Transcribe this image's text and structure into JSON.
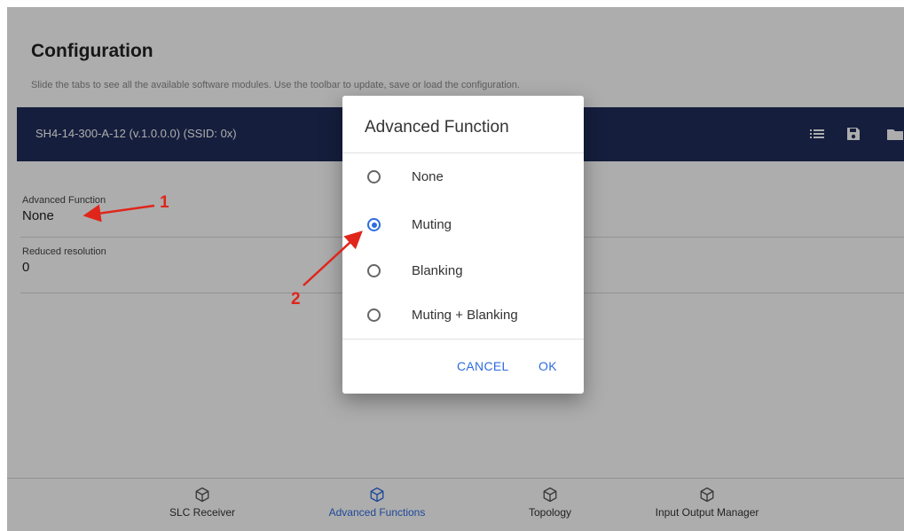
{
  "page": {
    "title": "Configuration",
    "subtitle": "Slide the tabs to see all the available software modules. Use the toolbar to update, save or load the configuration."
  },
  "device_bar": {
    "name": "SH4-14-300-A-12 (v.1.0.0.0) (SSID: 0x)",
    "icons": [
      "list-icon",
      "save-icon",
      "folder-icon"
    ]
  },
  "fields": [
    {
      "label": "Advanced Function",
      "value": "None"
    },
    {
      "label": "Reduced resolution",
      "value": "0"
    }
  ],
  "dialog": {
    "title": "Advanced Function",
    "options": [
      {
        "label": "None",
        "checked": false
      },
      {
        "label": "Muting",
        "checked": true
      },
      {
        "label": "Blanking",
        "checked": false
      },
      {
        "label": "Muting + Blanking",
        "checked": false
      }
    ],
    "cancel_label": "CANCEL",
    "ok_label": "OK"
  },
  "bottom_nav": [
    {
      "label": "SLC Receiver",
      "icon": "cube-icon",
      "active": false
    },
    {
      "label": "Advanced Functions",
      "icon": "cube-icon",
      "active": true
    },
    {
      "label": "Topology",
      "icon": "cube-icon",
      "active": false
    },
    {
      "label": "Input Output Manager",
      "icon": "cube-icon",
      "active": false
    }
  ],
  "annotations": [
    {
      "number": "1"
    },
    {
      "number": "2"
    }
  ],
  "colors": {
    "bar": "#1f2d5a",
    "accent": "#2d6cdf",
    "annotation": "#e0251b"
  }
}
